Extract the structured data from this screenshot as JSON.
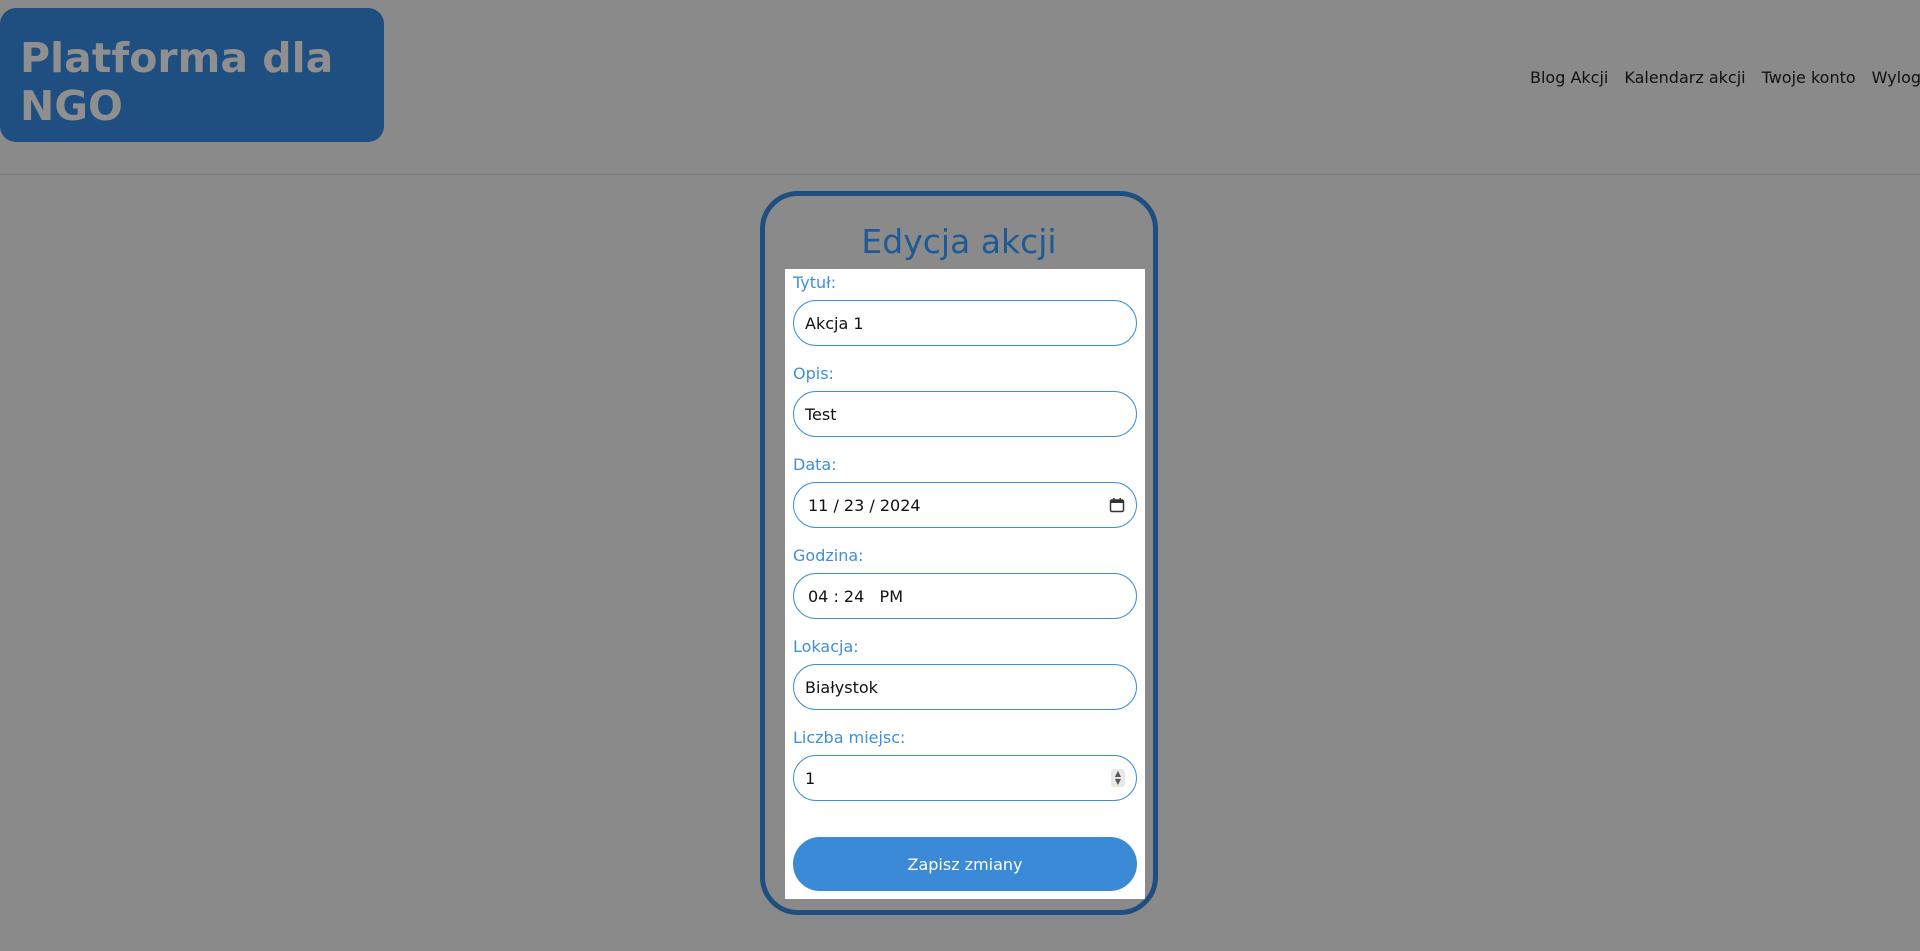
{
  "header": {
    "logo_text": "Platforma dla NGO",
    "nav": [
      "Blog Akcji",
      "Kalendarz akcji",
      "Twoje konto",
      "Wyloguj"
    ]
  },
  "form": {
    "title": "Edycja akcji",
    "fields": [
      {
        "label": "Tytuł:",
        "value": "Akcja 1"
      },
      {
        "label": "Opis:",
        "value": "Test"
      },
      {
        "label": "Data:",
        "value": "11 / 23 / 2024"
      },
      {
        "label": "Godzina:",
        "value": "04 : 24   PM"
      },
      {
        "label": "Lokacja:",
        "value": "Białystok"
      },
      {
        "label": "Liczba miejsc:",
        "value": "1"
      }
    ],
    "submit_label": "Zapisz zmiany"
  },
  "colors": {
    "brand": "#1e4f80",
    "accent": "#3a8ad8",
    "label": "#3f8fd8"
  }
}
